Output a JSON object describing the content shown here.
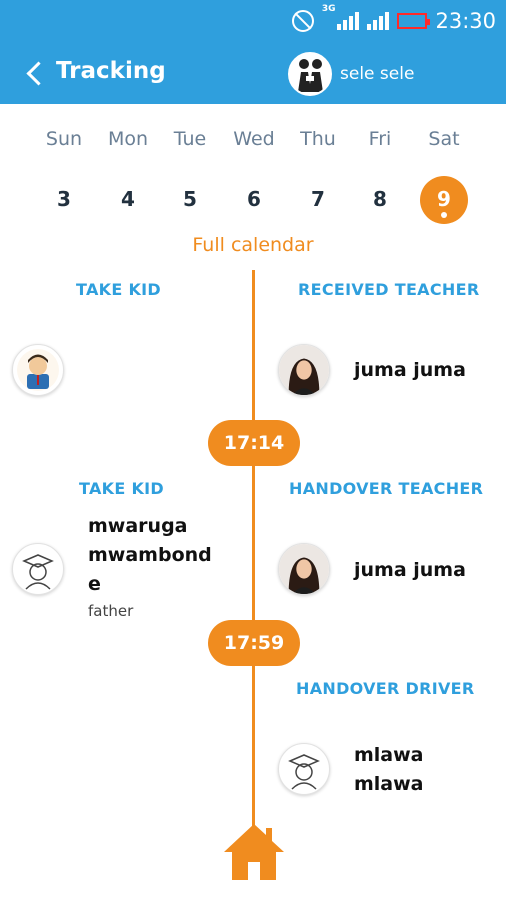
{
  "status_bar": {
    "network": "3G",
    "time": "23:30"
  },
  "header": {
    "title": "Tracking",
    "user_name": "sele sele"
  },
  "week": [
    {
      "name": "Sun",
      "num": "3"
    },
    {
      "name": "Mon",
      "num": "4"
    },
    {
      "name": "Tue",
      "num": "5"
    },
    {
      "name": "Wed",
      "num": "6"
    },
    {
      "name": "Thu",
      "num": "7"
    },
    {
      "name": "Fri",
      "num": "8"
    },
    {
      "name": "Sat",
      "num": "9"
    }
  ],
  "selected_day": "9",
  "full_calendar_label": "Full calendar",
  "events": [
    {
      "left_label": "TAKE KID",
      "right_label": "RECEIVED TEACHER",
      "right_name": "juma juma"
    },
    {
      "time": "17:14",
      "left_label": "TAKE KID",
      "left_name_lines": [
        "mwaruga",
        "mwambond",
        "e"
      ],
      "left_role": "father",
      "right_label": "HANDOVER TEACHER",
      "right_name": "juma juma"
    },
    {
      "time": "17:59",
      "right_label": "HANDOVER DRIVER",
      "right_name_lines": [
        "mlawa",
        "mlawa"
      ]
    }
  ],
  "colors": {
    "primary": "#2f9fdd",
    "accent": "#f08c1f",
    "battery_low": "#ff2a2a"
  },
  "icons": {
    "back": "back-arrow-icon",
    "home": "home-icon"
  }
}
